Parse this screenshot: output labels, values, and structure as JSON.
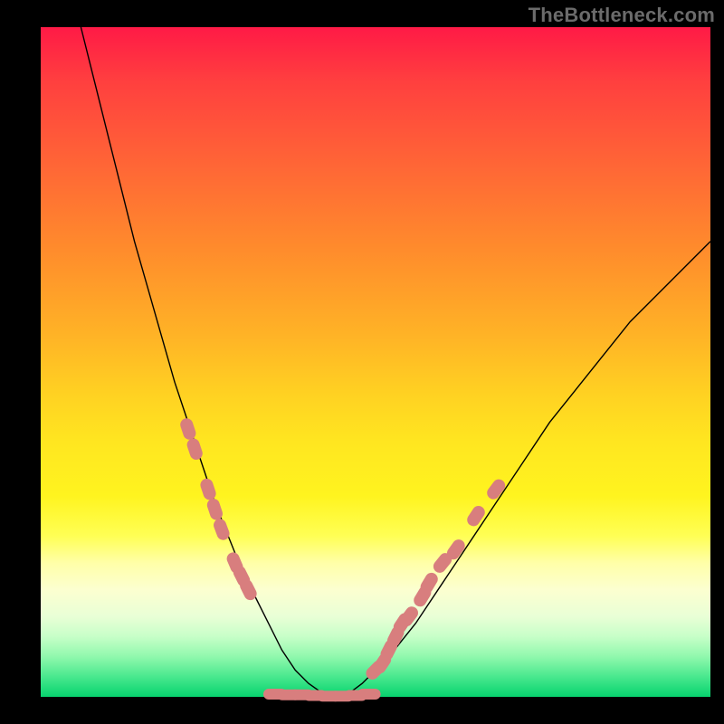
{
  "watermark": "TheBottleneck.com",
  "chart_data": {
    "type": "line",
    "title": "",
    "xlabel": "",
    "ylabel": "",
    "xlim": [
      0,
      100
    ],
    "ylim": [
      0,
      100
    ],
    "grid": false,
    "legend": false,
    "series": [
      {
        "name": "bottleneck-curve",
        "x": [
          6,
          8,
          10,
          12,
          14,
          16,
          18,
          20,
          22,
          24,
          26,
          28,
          30,
          32,
          34,
          36,
          38,
          40,
          42,
          44,
          46,
          48,
          52,
          56,
          60,
          64,
          68,
          72,
          76,
          80,
          84,
          88,
          92,
          96,
          100
        ],
        "y": [
          100,
          92,
          84,
          76,
          68,
          61,
          54,
          47,
          41,
          35,
          29,
          24,
          19,
          15,
          11,
          7,
          4,
          2,
          0.6,
          0,
          0.5,
          2,
          6,
          11,
          17,
          23,
          29,
          35,
          41,
          46,
          51,
          56,
          60,
          64,
          68
        ],
        "stroke": "#000000",
        "stroke_width": 1.4
      }
    ],
    "markers": [
      {
        "name": "left-cluster",
        "shape": "rounded-bar",
        "color": "#d87e7e",
        "points": [
          {
            "x": 22,
            "y": 40
          },
          {
            "x": 23,
            "y": 37
          },
          {
            "x": 25,
            "y": 31
          },
          {
            "x": 26,
            "y": 28
          },
          {
            "x": 27,
            "y": 25
          },
          {
            "x": 29,
            "y": 20
          },
          {
            "x": 30,
            "y": 18
          },
          {
            "x": 31,
            "y": 16
          }
        ]
      },
      {
        "name": "right-cluster",
        "shape": "rounded-bar",
        "color": "#d87e7e",
        "points": [
          {
            "x": 50,
            "y": 4
          },
          {
            "x": 51,
            "y": 5
          },
          {
            "x": 52,
            "y": 7
          },
          {
            "x": 53,
            "y": 9
          },
          {
            "x": 54,
            "y": 11
          },
          {
            "x": 55,
            "y": 12
          },
          {
            "x": 57,
            "y": 15
          },
          {
            "x": 58,
            "y": 17
          },
          {
            "x": 60,
            "y": 20
          },
          {
            "x": 62,
            "y": 22
          },
          {
            "x": 65,
            "y": 27
          },
          {
            "x": 68,
            "y": 31
          }
        ]
      },
      {
        "name": "bottom-cluster",
        "shape": "rounded-bar-horizontal",
        "color": "#d87e7e",
        "points": [
          {
            "x": 35,
            "y": 0.4
          },
          {
            "x": 37,
            "y": 0.3
          },
          {
            "x": 39,
            "y": 0.3
          },
          {
            "x": 41,
            "y": 0.2
          },
          {
            "x": 43,
            "y": 0.1
          },
          {
            "x": 45,
            "y": 0.1
          },
          {
            "x": 47,
            "y": 0.2
          },
          {
            "x": 49,
            "y": 0.4
          }
        ]
      }
    ],
    "background_gradient": {
      "top": "#ff1a46",
      "mid": "#ffe029",
      "bottom": "#07d36e"
    }
  }
}
